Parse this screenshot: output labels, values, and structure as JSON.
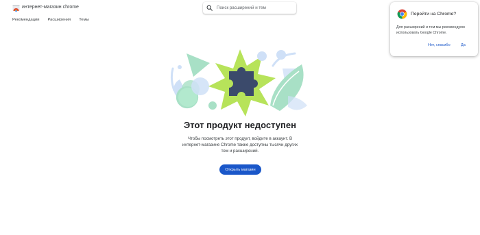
{
  "header": {
    "brand": "интернет-магазин chrome",
    "logo_icon": "chrome-web-store-icon",
    "search": {
      "placeholder": "Поиск расширений и тем",
      "value": "",
      "icon": "search-icon"
    }
  },
  "nav": {
    "items": [
      {
        "label": "Рекомендации"
      },
      {
        "label": "Расширения"
      },
      {
        "label": "Темы"
      }
    ]
  },
  "main": {
    "illustration_icon": "puzzle-piece-illustration",
    "title": "Этот продукт недоступен",
    "description": "Чтобы посмотреть этот продукт, войдите в аккаунт. В интернет-магазине Chrome также доступны тысячи других тем и расширений.",
    "button_label": "Открыть магазин"
  },
  "popup": {
    "icon": "chrome-logo-icon",
    "title": "Перейти на Chrome?",
    "text": "Для расширений и тем мы рекомендуем использовать Google Chrome.",
    "no_label": "Нет, спасибо",
    "yes_label": "Да"
  },
  "colors": {
    "accent": "#1a57c9",
    "star_green": "#b7e35a",
    "puzzle": "#3b4a6b",
    "mint": "#a8e0c6",
    "light_blue": "#cfe0f7"
  }
}
